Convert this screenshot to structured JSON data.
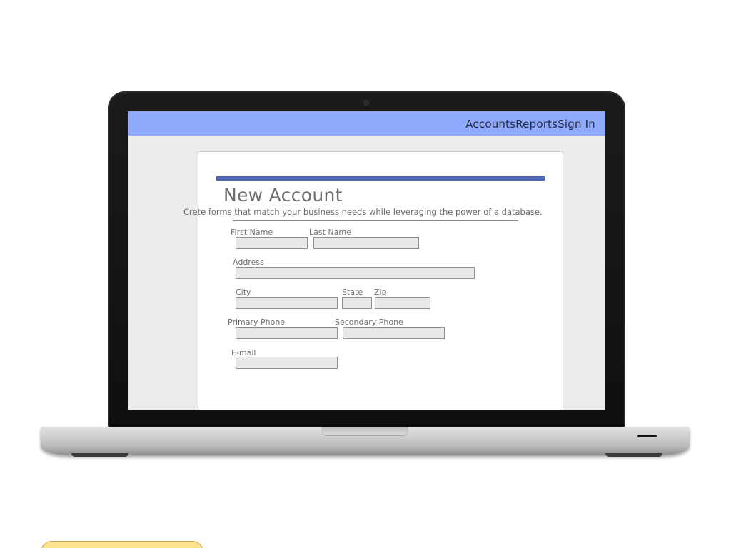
{
  "nav": {
    "links": [
      "Accounts",
      "Reports",
      "Sign In"
    ]
  },
  "form": {
    "title": "New Account",
    "subtitle": "Crete forms that match your business needs while leveraging the power of a database.",
    "fields": {
      "first_name": {
        "label": "First Name",
        "value": ""
      },
      "last_name": {
        "label": "Last Name",
        "value": ""
      },
      "address": {
        "label": "Address",
        "value": ""
      },
      "city": {
        "label": "City",
        "value": ""
      },
      "state": {
        "label": "State",
        "value": ""
      },
      "zip": {
        "label": "Zip",
        "value": ""
      },
      "primary_phone": {
        "label": "Primary Phone",
        "value": ""
      },
      "secondary_phone": {
        "label": "Secondary Phone",
        "value": ""
      },
      "email": {
        "label": "E-mail",
        "value": ""
      }
    }
  },
  "colors": {
    "nav_bar": "#8faafc",
    "accent": "#4c66b5",
    "screen_bg": "#ececec",
    "field_bg": "#e9e9e9",
    "badge": "#fde38e"
  }
}
